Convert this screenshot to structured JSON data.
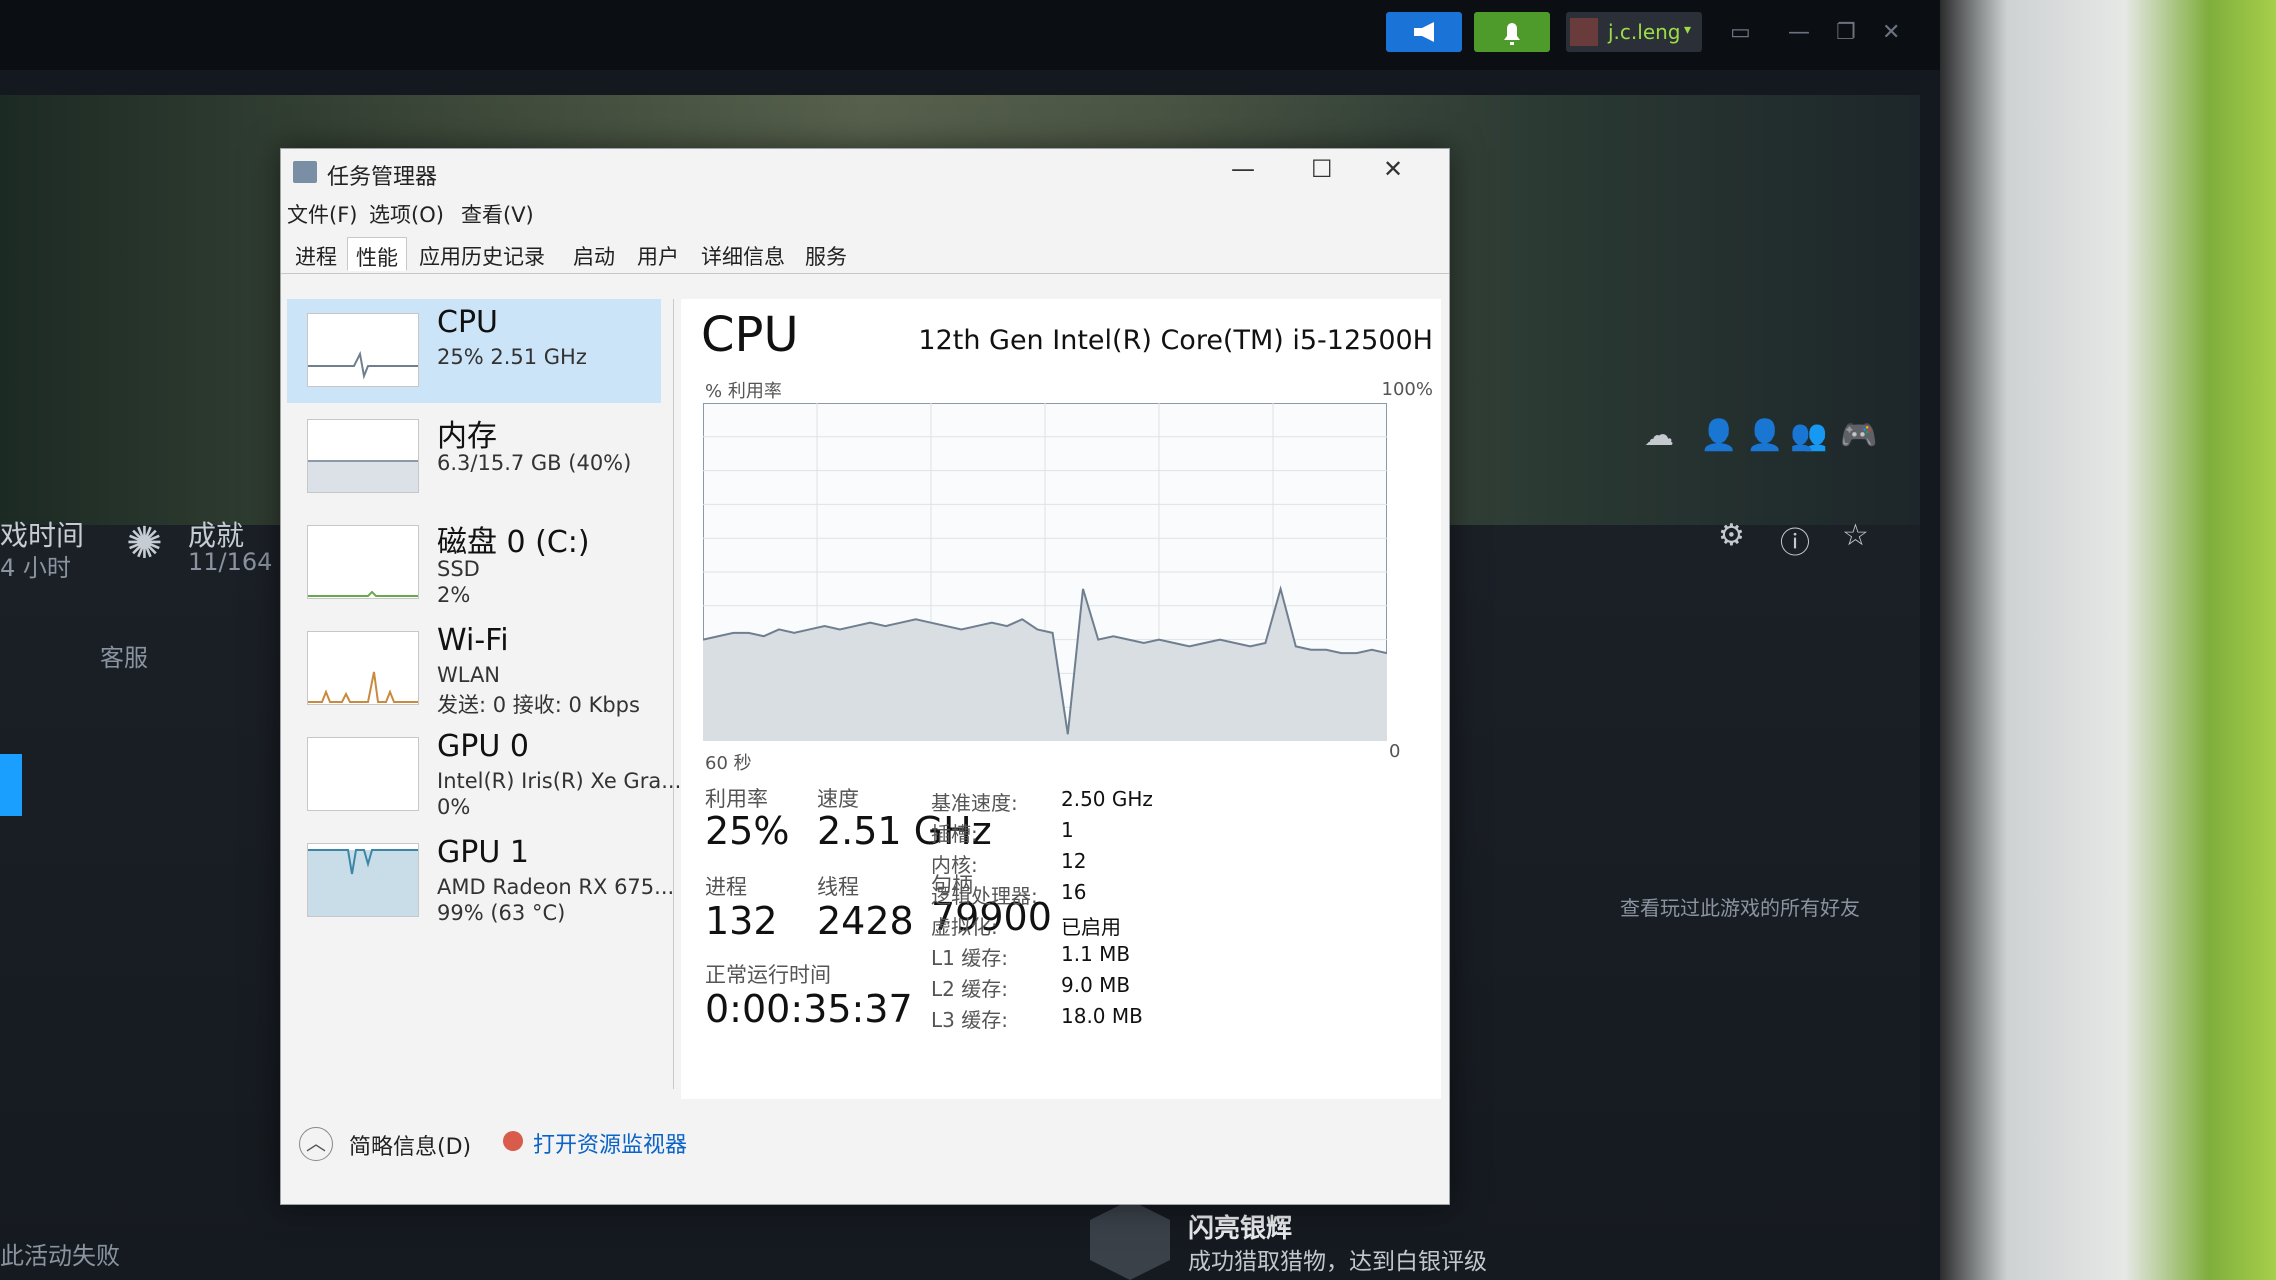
{
  "steam": {
    "username": "j.c.leng",
    "stats": {
      "playtime_label": "戏时间",
      "playtime_value": "4 小时",
      "achievements_label": "成就",
      "achievements_value": "11/164"
    },
    "support_link": "客服",
    "friends_link": "查看玩过此游戏的所有好友",
    "bottom_left_text": "此活动失败",
    "toast": {
      "title": "闪亮银辉",
      "description": "成功猎取猎物，达到白银评级"
    }
  },
  "taskmgr": {
    "title": "任务管理器",
    "menu": [
      "文件(F)",
      "选项(O)",
      "查看(V)"
    ],
    "tabs": [
      "进程",
      "性能",
      "应用历史记录",
      "启动",
      "用户",
      "详细信息",
      "服务"
    ],
    "active_tab": "性能",
    "resources": [
      {
        "name": "CPU",
        "line2": "25%  2.51 GHz",
        "line3": ""
      },
      {
        "name": "内存",
        "line2": "6.3/15.7 GB (40%)",
        "line3": ""
      },
      {
        "name": "磁盘 0 (C:)",
        "line2": "SSD",
        "line3": "2%"
      },
      {
        "name": "Wi-Fi",
        "line2": "WLAN",
        "line3": "发送: 0 接收: 0 Kbps"
      },
      {
        "name": "GPU 0",
        "line2": "Intel(R) Iris(R) Xe Gra...",
        "line3": "0%"
      },
      {
        "name": "GPU 1",
        "line2": "AMD Radeon RX 675...",
        "line3": "99% (63 °C)"
      }
    ],
    "cpu": {
      "heading": "CPU",
      "model": "12th Gen Intel(R) Core(TM) i5-12500H",
      "util_axis_label": "% 利用率",
      "axis_max": "100%",
      "axis_min": "0",
      "time_span": "60 秒",
      "utilization_label": "利用率",
      "utilization": "25%",
      "speed_label": "速度",
      "speed": "2.51 GHz",
      "processes_label": "进程",
      "processes": "132",
      "threads_label": "线程",
      "threads": "2428",
      "handles_label": "句柄",
      "handles": "79900",
      "uptime_label": "正常运行时间",
      "uptime": "0:00:35:37",
      "details": [
        {
          "k": "基准速度:",
          "v": "2.50 GHz"
        },
        {
          "k": "插槽:",
          "v": "1"
        },
        {
          "k": "内核:",
          "v": "12"
        },
        {
          "k": "逻辑处理器:",
          "v": "16"
        },
        {
          "k": "虚拟化:",
          "v": "已启用"
        },
        {
          "k": "L1 缓存:",
          "v": "1.1 MB"
        },
        {
          "k": "L2 缓存:",
          "v": "9.0 MB"
        },
        {
          "k": "L3 缓存:",
          "v": "18.0 MB"
        }
      ],
      "history": [
        30,
        31,
        32,
        32,
        31,
        33,
        32,
        33,
        34,
        33,
        34,
        35,
        34,
        35,
        36,
        35,
        34,
        33,
        34,
        35,
        34,
        36,
        33,
        32,
        2,
        45,
        30,
        31,
        30,
        29,
        30,
        29,
        28,
        29,
        30,
        29,
        28,
        29,
        45,
        28,
        27,
        27,
        26,
        26,
        27,
        26
      ]
    },
    "footer": {
      "fewer_details": "简略信息(D)",
      "resource_monitor": "打开资源监视器"
    }
  },
  "colors": {
    "graph_line": "#6f7f8f",
    "graph_fill": "#d9dee3",
    "selected_bg": "#cce4f7",
    "link": "#0b63c7"
  }
}
